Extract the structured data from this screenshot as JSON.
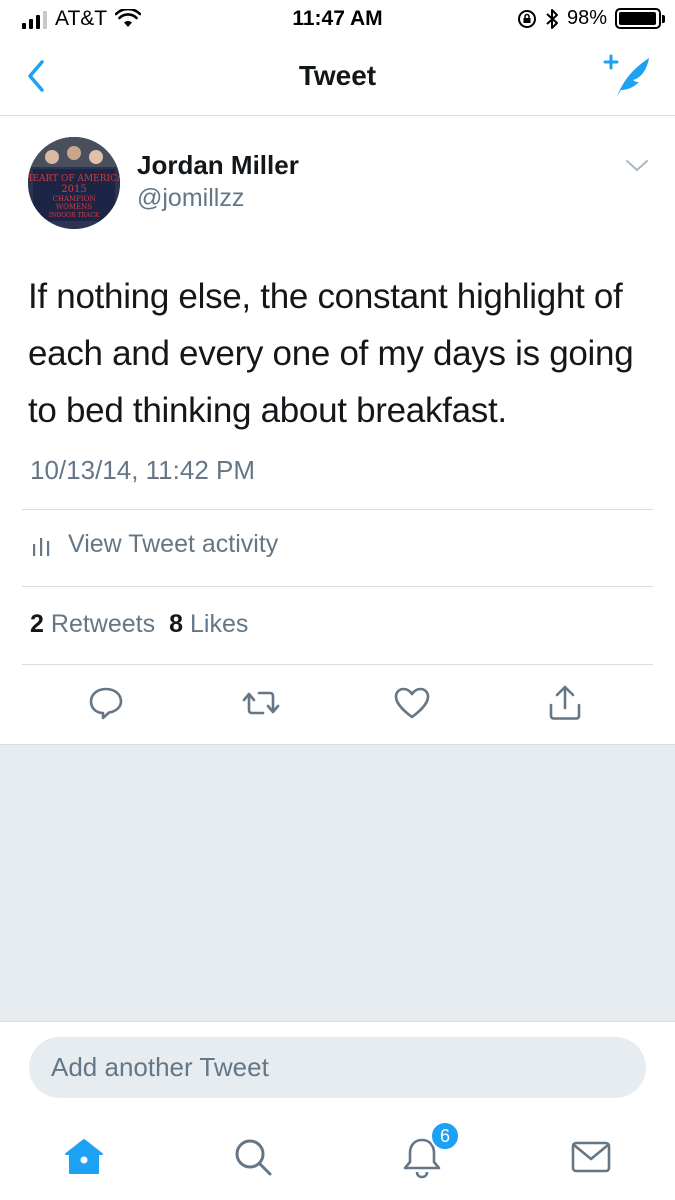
{
  "status_bar": {
    "carrier": "AT&T",
    "time": "11:47 AM",
    "battery_percent": "98%",
    "battery_level": 0.98
  },
  "nav": {
    "title": "Tweet",
    "back_icon": "chevron-left-icon",
    "compose_icon": "compose-tweet-icon"
  },
  "tweet": {
    "author_name": "Jordan Miller",
    "author_handle": "@jomillzz",
    "avatar_banner_lines": [
      "HEART OF AMERICA",
      "2015",
      "CHAMPION",
      "WOMENS",
      "INDOOR TRACK"
    ],
    "text": "If nothing else, the constant highlight of each and every one of my days is going to bed thinking about breakfast.",
    "timestamp": "10/13/14, 11:42 PM",
    "activity_label": "View Tweet activity",
    "retweets_count": "2",
    "retweets_label": "Retweets",
    "likes_count": "8",
    "likes_label": "Likes"
  },
  "actions": [
    "reply-icon",
    "retweet-icon",
    "like-icon",
    "share-icon"
  ],
  "reply": {
    "placeholder": "Add another Tweet"
  },
  "tab_bar": {
    "tabs": [
      "home-icon",
      "search-icon",
      "notifications-icon",
      "messages-icon"
    ],
    "notifications_badge": "6"
  },
  "colors": {
    "accent": "#1da1f2",
    "secondary_text": "#657786",
    "background_gray": "#e6ecf0"
  }
}
